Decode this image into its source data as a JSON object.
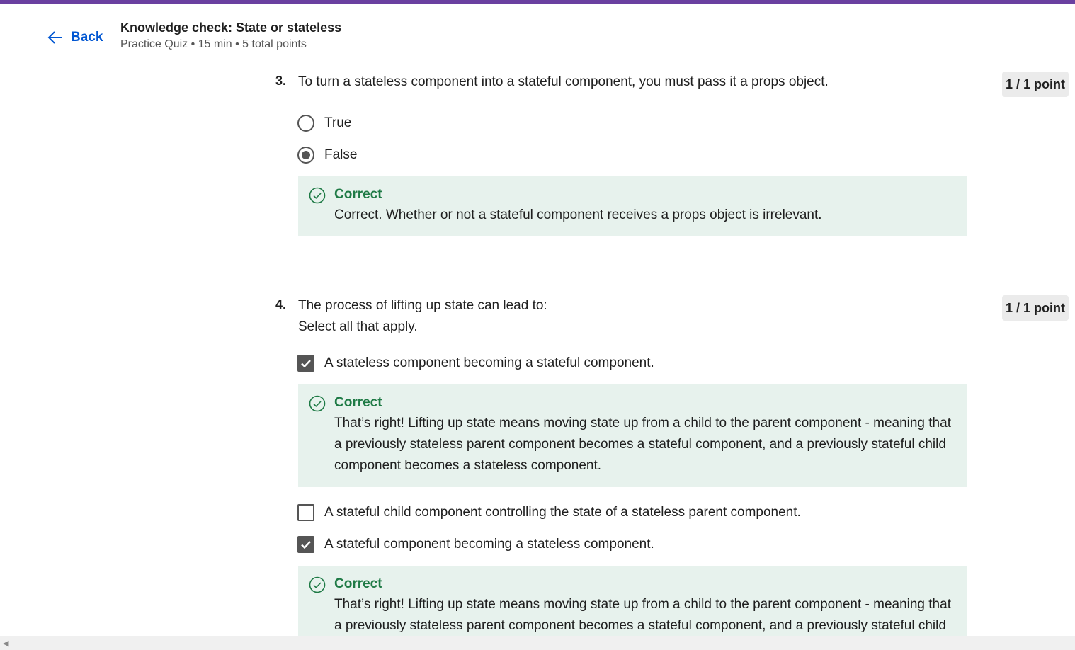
{
  "header": {
    "back_label": "Back",
    "title": "Knowledge check: State or stateless",
    "meta": "Practice Quiz • 15 min • 5 total points"
  },
  "questions": [
    {
      "number": "3.",
      "text": "To turn a stateless component into a stateful component, you must pass it a props object.",
      "points": "1 / 1 point",
      "options": [
        {
          "label": "True",
          "selected": false
        },
        {
          "label": "False",
          "selected": true
        }
      ],
      "feedback": {
        "title": "Correct",
        "text": "Correct. Whether or not a stateful component receives a props object is irrelevant."
      }
    },
    {
      "number": "4.",
      "text": "The process of lifting up state can lead to:",
      "instruction": "Select all that apply.",
      "points": "1 / 1 point",
      "options": [
        {
          "label": "A stateless component becoming a stateful component.",
          "checked": true,
          "feedback": {
            "title": "Correct",
            "text": "That’s right! Lifting up state means moving state up from a child to the parent component - meaning that a previously stateless parent component becomes a stateful component, and a previously stateful child component becomes a stateless component."
          }
        },
        {
          "label": "A stateful child component controlling the state of a stateless parent component.",
          "checked": false
        },
        {
          "label": "A stateful component becoming a stateless component.",
          "checked": true,
          "feedback": {
            "title": "Correct",
            "text": "That’s right! Lifting up state means moving state up from a child to the parent component - meaning that a previously stateless parent component becomes a stateful component, and a previously stateful child component becomes a stateless component."
          }
        }
      ]
    }
  ],
  "colors": {
    "brand_bar": "#6a40a0",
    "link": "#0056d2",
    "correct": "#1e7a45",
    "feedback_bg": "#e7f2ed"
  },
  "icons": [
    "arrow-left-icon",
    "check-circle-icon",
    "checkmark-icon"
  ]
}
